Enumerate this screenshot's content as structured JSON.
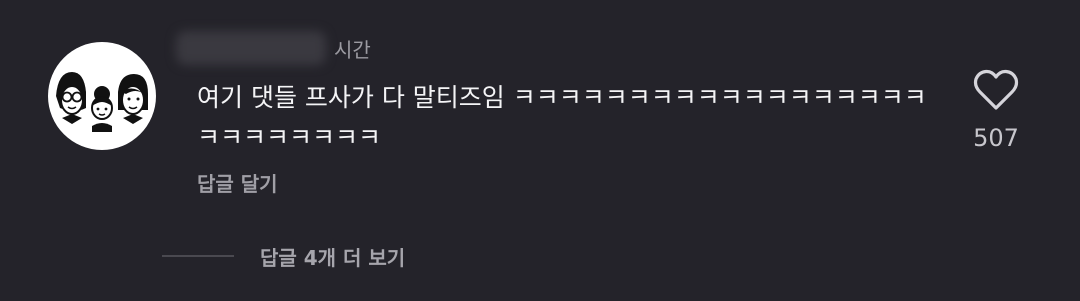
{
  "comment": {
    "timestamp": "시간",
    "text": "여기 댓들 프사가 다 말티즈임 ㅋㅋㅋㅋㅋㅋㅋㅋㅋㅋㅋㅋㅋㅋㅋㅋㅋㅋㅋㅋㅋㅋㅋㅋㅋㅋ",
    "reply_label": "답글 달기",
    "like_count": "507",
    "more_replies_label": "답글 4개 더 보기"
  },
  "icons": {
    "like": "heart-outline-icon",
    "avatar": "cartoon-family-avatar"
  },
  "colors": {
    "background": "#24232a",
    "text": "#f4f4f6",
    "muted": "#9b9aa1"
  }
}
